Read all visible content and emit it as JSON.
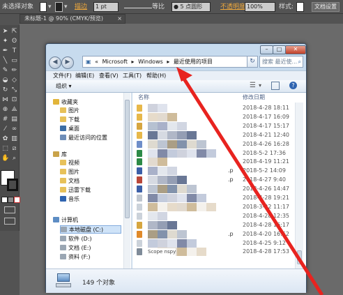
{
  "illustrator": {
    "selection_label": "未选择对象",
    "stroke_label": "描边",
    "stroke_weight": "1 pt",
    "profile_label": "等比",
    "brush_label": "5 点圆形",
    "opacity_label": "不透明度",
    "opacity_value": "100%",
    "style_label": "样式:",
    "doc_settings_button": "文档设置",
    "doc_tab": "未标题-1 @ 90% (CMYK/预览)"
  },
  "explorer": {
    "address": {
      "prefix": "«",
      "crumbs": [
        "Microsoft",
        "Windows",
        "最近使用的项目"
      ],
      "separator": "▸"
    },
    "search_placeholder": "搜索 最近使...",
    "menu": [
      "文件(F)",
      "编辑(E)",
      "查看(V)",
      "工具(T)",
      "帮助(H)"
    ],
    "organize_label": "组织 ▾",
    "columns": {
      "name": "名称",
      "modified": "修改日期"
    },
    "nav_items": [
      {
        "label": "收藏夹",
        "icon": "star-icon",
        "level": 0
      },
      {
        "label": "图片",
        "icon": "folder-icon",
        "level": 1
      },
      {
        "label": "下载",
        "icon": "folder-icon",
        "level": 1
      },
      {
        "label": "桌面",
        "icon": "desktop-icon",
        "level": 1
      },
      {
        "label": "最近访问的位置",
        "icon": "recent-icon",
        "level": 1
      },
      {
        "label": "库",
        "icon": "library-icon",
        "level": 0
      },
      {
        "label": "视频",
        "icon": "folder-icon",
        "level": 1
      },
      {
        "label": "图片",
        "icon": "folder-icon",
        "level": 1
      },
      {
        "label": "文档",
        "icon": "folder-icon",
        "level": 1
      },
      {
        "label": "迅雷下载",
        "icon": "folder-icon",
        "level": 1
      },
      {
        "label": "音乐",
        "icon": "music-icon",
        "level": 1
      },
      {
        "label": "计算机",
        "icon": "computer-icon",
        "level": 0
      },
      {
        "label": "本地磁盘 (C:)",
        "icon": "drive-icon",
        "level": 1,
        "selected": true
      },
      {
        "label": "软件 (D:)",
        "icon": "drive-icon",
        "level": 1
      },
      {
        "label": "文档 (E:)",
        "icon": "drive-icon",
        "level": 1
      },
      {
        "label": "资料 (F:)",
        "icon": "drive-icon",
        "level": 1
      }
    ],
    "files": [
      {
        "date": "2018-4-28 18:11"
      },
      {
        "date": "2018-4-17 16:09"
      },
      {
        "date": "2018-4-17 15:17"
      },
      {
        "date": "2018-4-21 12:40"
      },
      {
        "date": "2018-4-26 16:28"
      },
      {
        "date": "2018-5-2 17:36"
      },
      {
        "date": "2018-4-19 11:21"
      },
      {
        "date": "2018-5-2 14:09"
      },
      {
        "date": "2018-4-27 9:40"
      },
      {
        "date": "2018-4-26 14:47"
      },
      {
        "date": "2018-4-28 19:21"
      },
      {
        "date": "2018-3-22 11:17"
      },
      {
        "date": "2018-4-28 12:35"
      },
      {
        "date": "2018-4-28 16:17"
      },
      {
        "date": "2018-4-20 16:52"
      },
      {
        "date": "2018-4-25 9:12"
      },
      {
        "date": "2018-4-28 17:53"
      }
    ],
    "extra_name_fragments": [
      ".p",
      ".p",
      ".p"
    ],
    "last_row_name": "Scope nspy",
    "status_count": "149 个对象"
  }
}
